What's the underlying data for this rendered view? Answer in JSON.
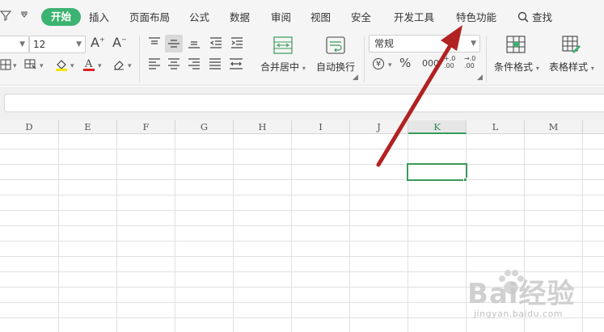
{
  "menu": {
    "tabs": [
      {
        "label": "开始",
        "active": true
      },
      {
        "label": "插入"
      },
      {
        "label": "页面布局"
      },
      {
        "label": "公式"
      },
      {
        "label": "数据"
      },
      {
        "label": "审阅"
      },
      {
        "label": "视图"
      },
      {
        "label": "安全"
      },
      {
        "label": "开发工具"
      },
      {
        "label": "特色功能"
      }
    ],
    "search_label": "查找"
  },
  "ribbon": {
    "font_size": "12",
    "number_format": "常规",
    "merge_center_label": "合并居中",
    "wrap_text_label": "自动换行",
    "conditional_format_label": "条件格式",
    "table_style_label": "表格样式",
    "currency_symbol": "¥",
    "percent_symbol": "%",
    "thousands_symbol": "000",
    "increase_decimal": "+.0 .00",
    "decrease_decimal": "→.0 .00"
  },
  "formula_bar": {
    "value": ""
  },
  "sheet": {
    "columns": [
      "D",
      "E",
      "F",
      "G",
      "H",
      "I",
      "J",
      "K",
      "L",
      "M"
    ],
    "selected_column": "K",
    "selected_cell": "K"
  },
  "annotation": {
    "arrow_color": "#b22222",
    "target": "特色功能"
  },
  "watermark": {
    "brand": "Bai经验",
    "url": "jingyan.baidu.com"
  },
  "colors": {
    "accent": "#3cb371",
    "selection": "#3a9a5a",
    "arrow": "#b22222"
  }
}
